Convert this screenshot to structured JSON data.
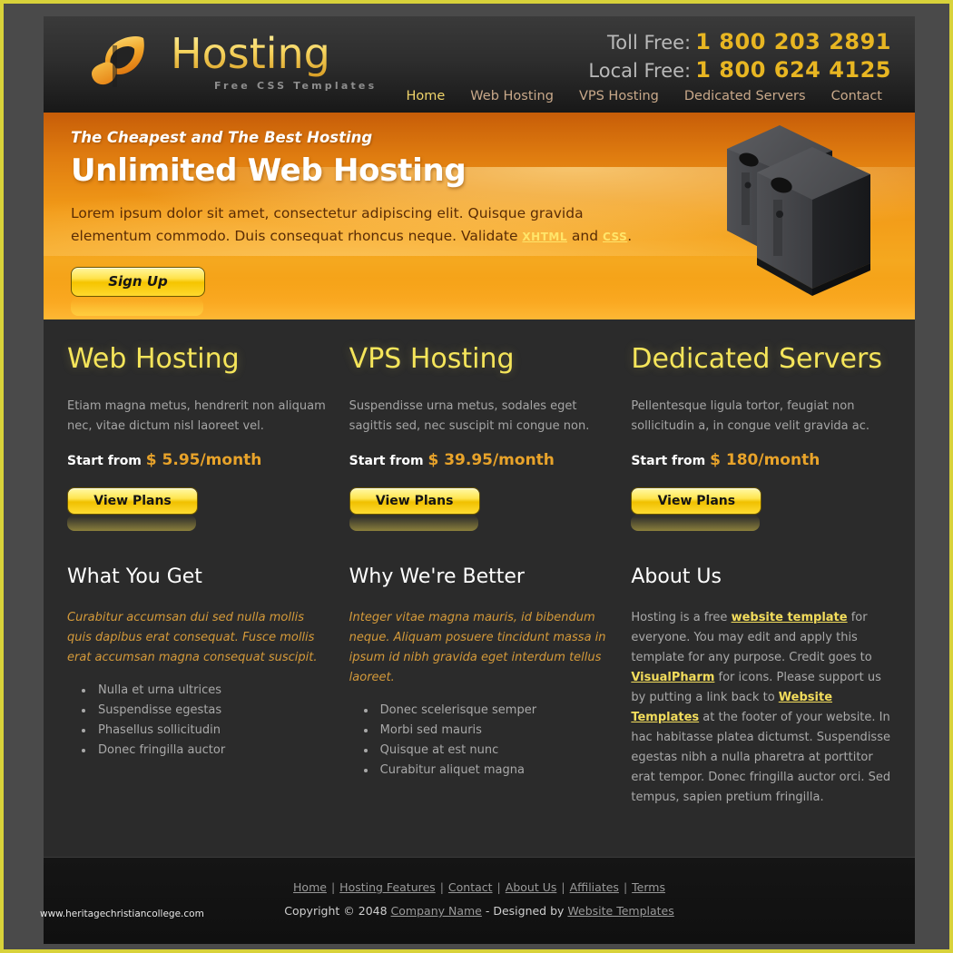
{
  "site": {
    "logo_text": "Hosting",
    "logo_sub": "Free CSS Templates"
  },
  "header": {
    "toll_label": "Toll Free:",
    "toll_number": "1 800 203 2891",
    "local_label": "Local Free:",
    "local_number": "1 800 624 4125",
    "nav": [
      {
        "label": "Home",
        "active": true
      },
      {
        "label": "Web Hosting",
        "active": false
      },
      {
        "label": "VPS Hosting",
        "active": false
      },
      {
        "label": "Dedicated Servers",
        "active": false
      },
      {
        "label": "Contact",
        "active": false
      }
    ]
  },
  "banner": {
    "kicker": "The Cheapest and The Best Hosting",
    "title": "Unlimited Web Hosting",
    "desc_part1": "Lorem ipsum dolor sit amet, consectetur adipiscing elit. Quisque gravida elementum commodo. Duis consequat rhoncus neque. Validate ",
    "link_xhtml": "XHTML",
    "desc_mid": " and ",
    "link_css": "CSS",
    "desc_end": ".",
    "signup_label": "Sign Up"
  },
  "services": [
    {
      "title": "Web Hosting",
      "desc": "Etiam magna metus, hendrerit non aliquam nec, vitae dictum nisl laoreet vel.",
      "price_label": "Start from",
      "price": "$ 5.95/month",
      "button": "View Plans"
    },
    {
      "title": "VPS Hosting",
      "desc": "Suspendisse urna metus, sodales eget sagittis sed, nec suscipit mi congue non.",
      "price_label": "Start from",
      "price": "$ 39.95/month",
      "button": "View Plans"
    },
    {
      "title": "Dedicated Servers",
      "desc": "Pellentesque ligula tortor, feugiat non sollicitudin a, in congue velit gravida ac.",
      "price_label": "Start from",
      "price": "$ 180/month",
      "button": "View Plans"
    }
  ],
  "sections": {
    "what_you_get": {
      "title": "What You Get",
      "intro": "Curabitur accumsan dui sed nulla mollis quis dapibus erat consequat. Fusce mollis erat accumsan magna consequat suscipit.",
      "items": [
        "Nulla et urna ultrices",
        "Suspendisse egestas",
        "Phasellus sollicitudin",
        "Donec fringilla auctor"
      ]
    },
    "why_better": {
      "title": "Why We're Better",
      "intro": "Integer vitae magna mauris, id bibendum neque. Aliquam posuere tincidunt massa in ipsum id nibh gravida eget interdum tellus laoreet.",
      "items": [
        "Donec scelerisque semper",
        "Morbi sed mauris",
        "Quisque at est nunc",
        "Curabitur aliquet magna"
      ]
    },
    "about_us": {
      "title": "About Us",
      "p1": "Hosting is a free ",
      "link1": "website template",
      "p2": " for everyone. You may edit and apply this template for any purpose. Credit goes to ",
      "link2": "VisualPharm",
      "p3": " for icons. Please support us by putting a link back to ",
      "link3": "Website Templates",
      "p4": " at the footer of your website. In hac habitasse platea dictumst. Suspendisse egestas nibh a nulla pharetra at porttitor erat tempor. Donec fringilla auctor orci. Sed tempus, sapien pretium fringilla."
    }
  },
  "footer": {
    "links": [
      "Home",
      "Hosting Features",
      "Contact",
      "About Us",
      "Affiliates",
      "Terms"
    ],
    "separator": "|",
    "copyright_prefix": "Copyright © 2048 ",
    "company": "Company Name",
    "designed_by_prefix": " - Designed by ",
    "designer": "Website Templates"
  },
  "watermark": "www.heritagechristiancollege.com",
  "colors": {
    "accent_yellow": "#f5e55a",
    "accent_orange": "#e8a32a",
    "banner_orange": "#f29b18",
    "page_bg": "#2b2b2b",
    "border": "#d8d23a"
  }
}
